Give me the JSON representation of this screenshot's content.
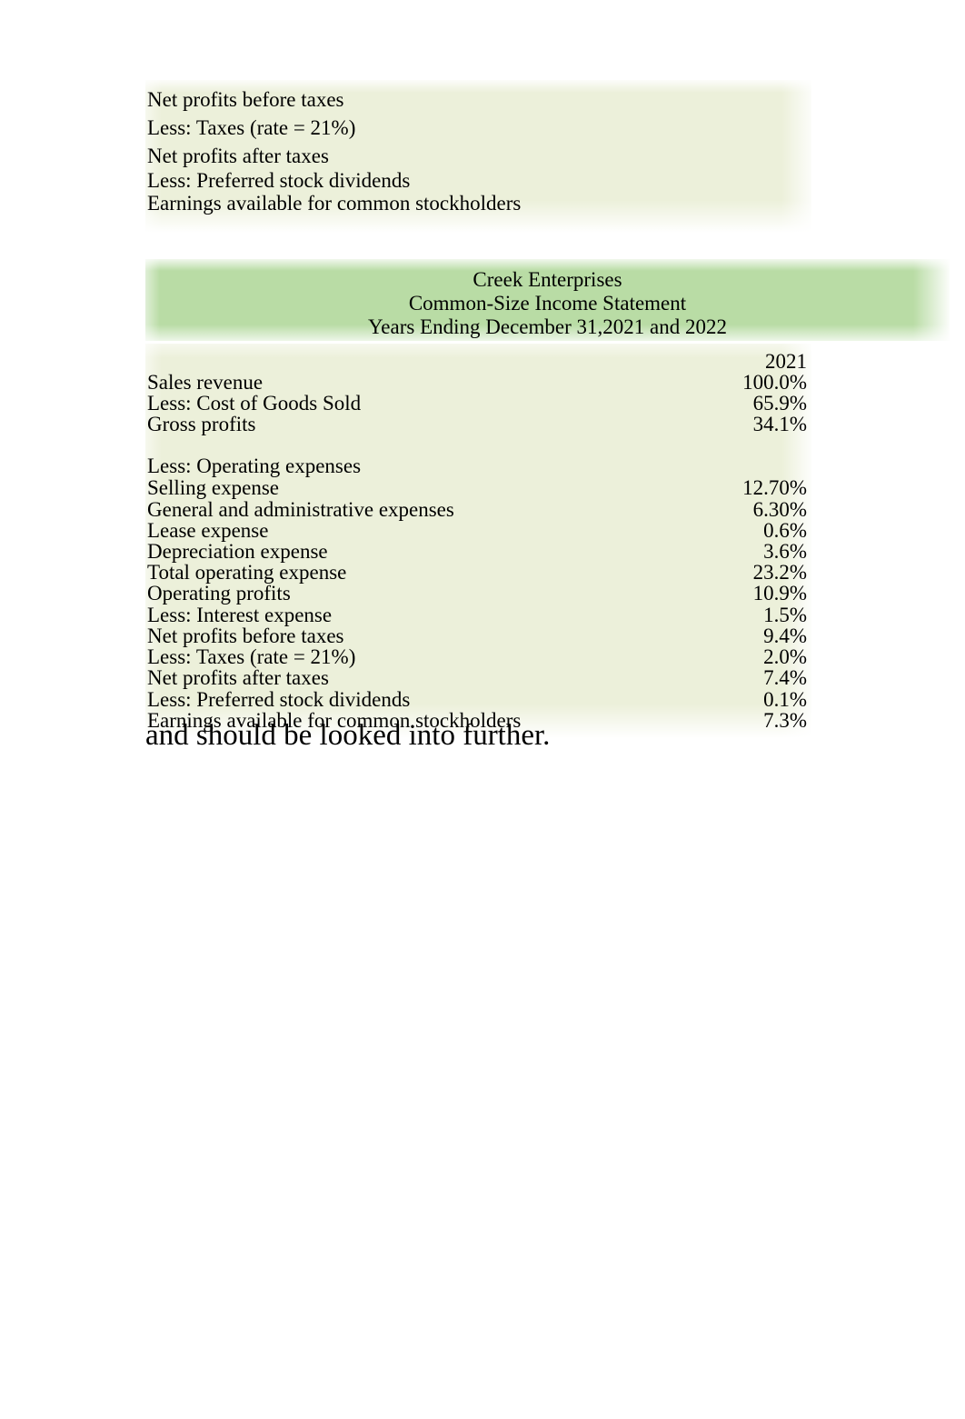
{
  "fragment_block": {
    "rows": [
      {
        "label": "Net profits before taxes"
      },
      {
        "label": "Less: Taxes (rate = 21%)"
      },
      {
        "label": "Net profits after taxes"
      },
      {
        "label": "Less: Preferred stock dividends"
      },
      {
        "label": "Earnings available for common stockholders"
      }
    ]
  },
  "statement": {
    "title_lines": [
      "Creek Enterprises",
      "Common-Size Income Statement",
      "Years Ending December 31,2021 and 2022"
    ],
    "column_header": "2021",
    "rows": [
      {
        "label": "Sales revenue",
        "value": "100.0%"
      },
      {
        "label": "Less: Cost of Goods Sold",
        "value": "65.9%"
      },
      {
        "label": "Gross profits",
        "value": "34.1%"
      },
      {
        "label": "",
        "value": ""
      },
      {
        "label": "Less: Operating expenses",
        "value": ""
      },
      {
        "label": "Selling expense",
        "value": "12.70%"
      },
      {
        "label": "General and administrative expenses",
        "value": "6.30%"
      },
      {
        "label": "Lease expense",
        "value": "0.6%"
      },
      {
        "label": "Depreciation expense",
        "value": "3.6%"
      },
      {
        "label": "Total operating expense",
        "value": "23.2%"
      },
      {
        "label": "Operating profits",
        "value": "10.9%"
      },
      {
        "label": "Less: Interest expense",
        "value": "1.5%"
      },
      {
        "label": "Net profits before taxes",
        "value": "9.4%"
      },
      {
        "label": "Less: Taxes (rate = 21%)",
        "value": "2.0%"
      },
      {
        "label": "Net profits after taxes",
        "value": "7.4%"
      },
      {
        "label": "Less: Preferred stock dividends",
        "value": "0.1%"
      },
      {
        "label": "Earnings available for common stockholders",
        "value": "7.3%"
      }
    ]
  },
  "analysis_note": {
    "text": "and should be looked into further."
  },
  "colors": {
    "body_background": "#ecf0da",
    "title_band": "#b9dca5",
    "text": "#000000",
    "page": "#ffffff"
  }
}
